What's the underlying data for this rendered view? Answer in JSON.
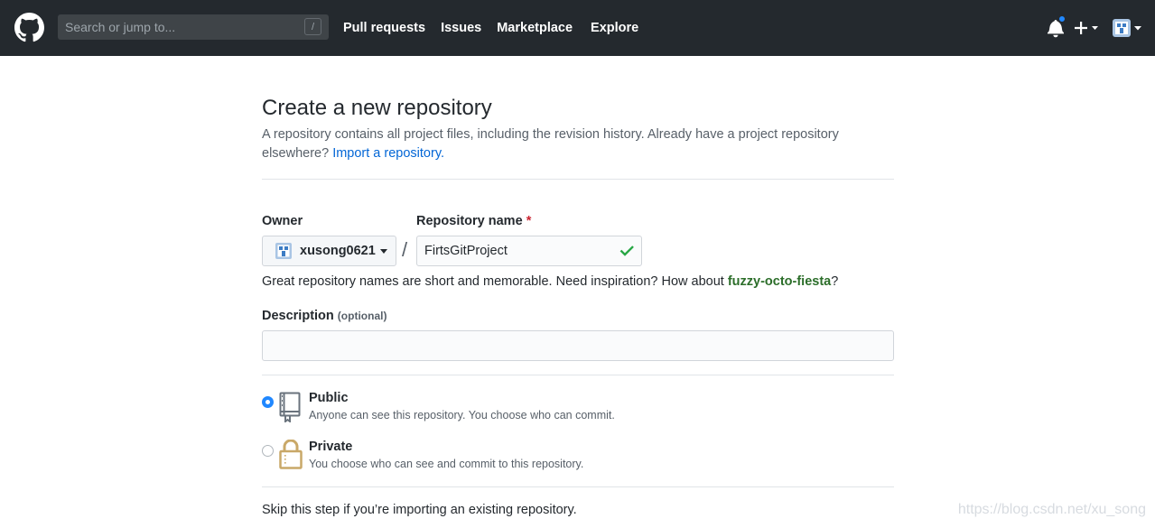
{
  "header": {
    "search_placeholder": "Search or jump to...",
    "search_shortcut": "/",
    "nav": [
      "Pull requests",
      "Issues",
      "Marketplace",
      "Explore"
    ]
  },
  "main": {
    "title": "Create a new repository",
    "subtitle_text": "A repository contains all project files, including the revision history. Already have a project repository elsewhere? ",
    "import_link": "Import a repository.",
    "owner_label": "Owner",
    "owner_value": "xusong0621",
    "separator": "/",
    "repo_name_label": "Repository name",
    "required_mark": "*",
    "repo_name_value": "FirtsGitProject",
    "hint_text": "Great repository names are short and memorable. Need inspiration? How about ",
    "hint_suggestion": "fuzzy-octo-fiesta",
    "hint_end": "?",
    "description_label": "Description",
    "description_optional": "(optional)",
    "description_value": "",
    "visibility": {
      "public_title": "Public",
      "public_desc": "Anyone can see this repository. You choose who can commit.",
      "private_title": "Private",
      "private_desc": "You choose who can see and commit to this repository.",
      "selected": "public"
    },
    "skip_text": "Skip this step if you’re importing an existing repository."
  },
  "watermark": "https://blog.csdn.net/xu_song",
  "colors": {
    "header_bg": "#24292e",
    "link": "#0366d6",
    "success": "#28a745",
    "notification": "#2188ff"
  }
}
